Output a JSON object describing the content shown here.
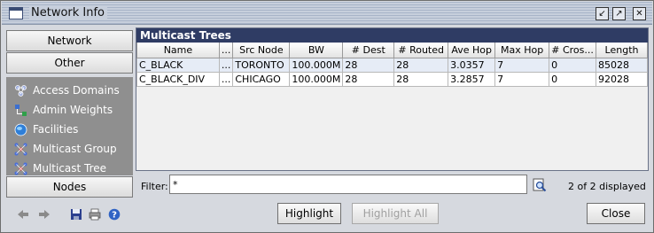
{
  "window": {
    "title": "Network Info"
  },
  "sidebar": {
    "network_label": "Network",
    "other_label": "Other",
    "nodes_label": "Nodes",
    "items": [
      {
        "label": "Access Domains",
        "icon": "access-domains-icon"
      },
      {
        "label": "Admin Weights",
        "icon": "admin-weights-icon"
      },
      {
        "label": "Facilities",
        "icon": "facilities-icon"
      },
      {
        "label": "Multicast Group",
        "icon": "multicast-group-icon"
      },
      {
        "label": "Multicast Tree",
        "icon": "multicast-tree-icon"
      }
    ]
  },
  "panel": {
    "title": "Multicast Trees",
    "columns": [
      "Name",
      "...",
      "Src Node",
      "BW",
      "# Dest",
      "# Routed",
      "Ave Hop",
      "Max Hop",
      "# Cros...",
      "Length"
    ],
    "rows": [
      [
        "C_BLACK",
        "...",
        "TORONTO",
        "100.000M",
        "28",
        "28",
        "3.0357",
        "7",
        "0",
        "85028"
      ],
      [
        "C_BLACK_DIV",
        "...",
        "CHICAGO",
        "100.000M",
        "28",
        "28",
        "3.2857",
        "7",
        "0",
        "92028"
      ]
    ]
  },
  "filter": {
    "label": "Filter:",
    "value": "*",
    "count": "2 of 2 displayed"
  },
  "buttons": {
    "highlight": "Highlight",
    "highlight_all": "Highlight All",
    "close": "Close"
  },
  "colors": {
    "panel_header": "#2f3c64",
    "sidebar_bg": "#8f8f8f",
    "selected_row": "#e6ecf6"
  }
}
